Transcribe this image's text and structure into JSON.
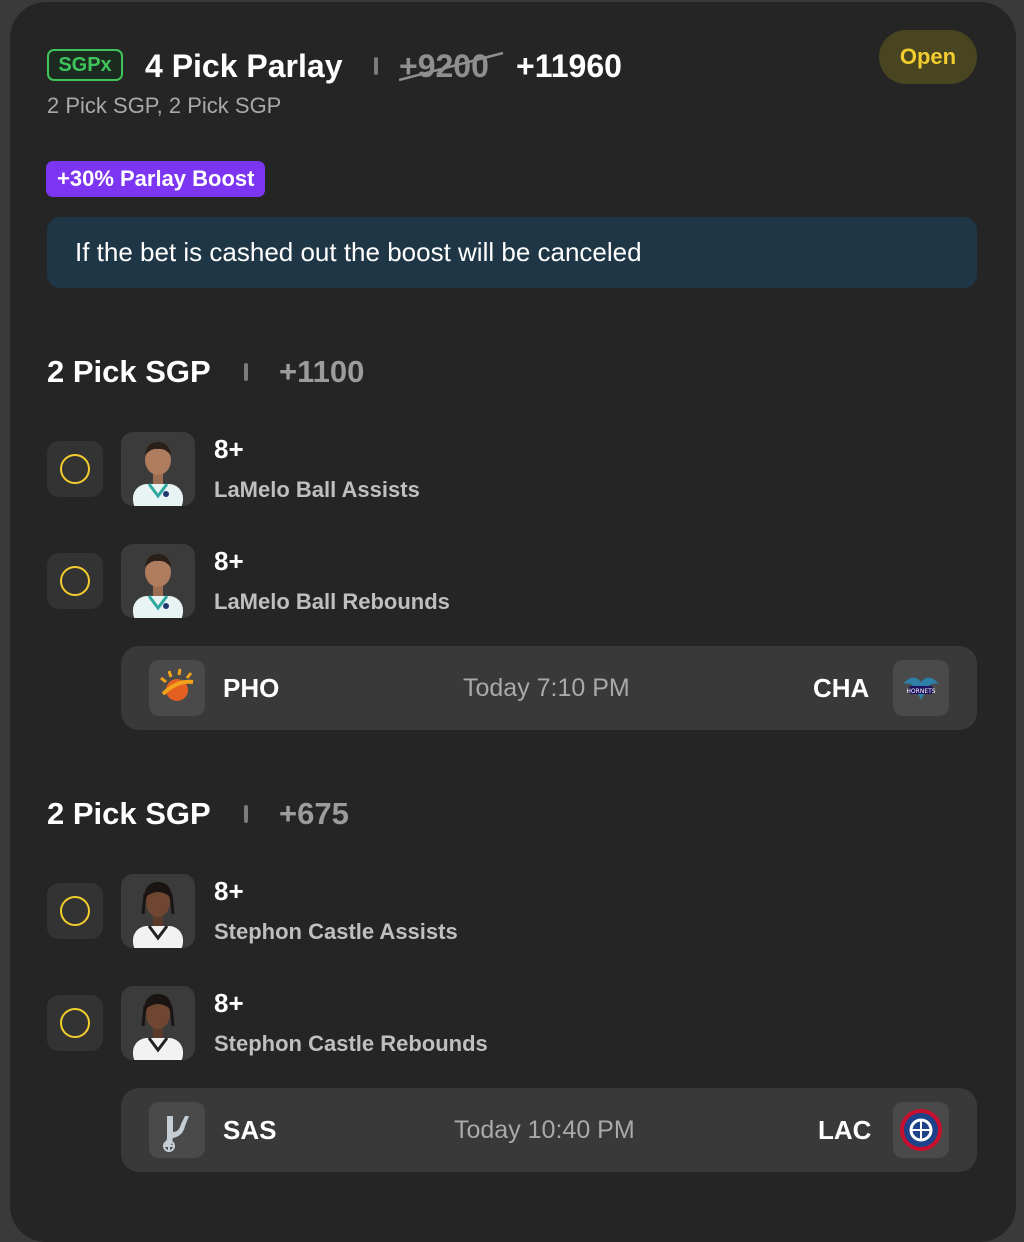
{
  "header": {
    "badge": "SGPx",
    "title": "4 Pick Parlay",
    "original_odds": "+9200",
    "boosted_odds": "+11960",
    "subtitle": "2 Pick SGP, 2 Pick SGP",
    "status": "Open"
  },
  "boost": {
    "badge": "+30% Parlay Boost",
    "notice": "If the bet is cashed out the boost will be canceled"
  },
  "groups": [
    {
      "title": "2 Pick SGP",
      "odds": "+1100",
      "picks": [
        {
          "value": "8+",
          "label": "LaMelo Ball Assists"
        },
        {
          "value": "8+",
          "label": "LaMelo Ball Rebounds"
        }
      ],
      "game": {
        "away": "PHO",
        "time": "Today 7:10 PM",
        "home": "CHA"
      }
    },
    {
      "title": "2 Pick SGP",
      "odds": "+675",
      "picks": [
        {
          "value": "8+",
          "label": "Stephon Castle Assists"
        },
        {
          "value": "8+",
          "label": "Stephon Castle Rebounds"
        }
      ],
      "game": {
        "away": "SAS",
        "time": "Today 10:40 PM",
        "home": "LAC"
      }
    }
  ],
  "colors": {
    "accent_yellow": "#f2cd2e",
    "sgpx_green": "#3ec45b",
    "boost_purple": "#7c35f0",
    "notice_bg": "#1e3645",
    "card_bg": "#252525"
  },
  "icons": {
    "pick_status": "circle-outline-icon",
    "pho_logo": "suns-logo-icon",
    "cha_logo": "hornets-logo-icon",
    "sas_logo": "spurs-logo-icon",
    "lac_logo": "clippers-logo-icon"
  }
}
